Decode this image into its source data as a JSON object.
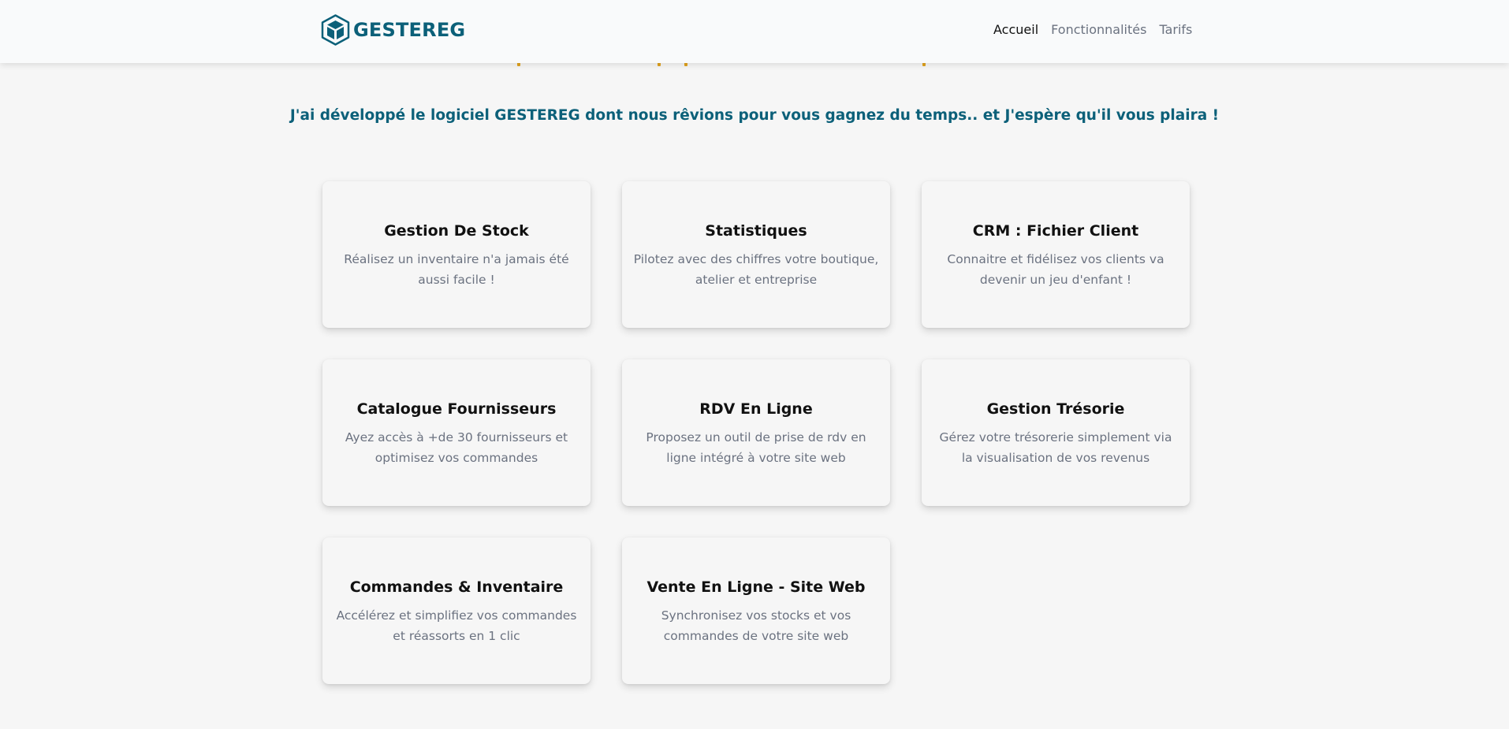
{
  "header": {
    "brand_name": "GESTEREG",
    "brand_colors": {
      "primary": "#0c6079",
      "accent": "#e0a21e"
    },
    "logo_icon": "cube-icon",
    "nav": [
      {
        "label": "Accueil",
        "active": true
      },
      {
        "label": "Fonctionnalités",
        "active": false
      },
      {
        "label": "Tarifs",
        "active": false
      }
    ]
  },
  "intro": {
    "subtitle": "J'ai développé le logiciel GESTEREG dont nous rêvions pour vous gagnez du temps.. et J'espère qu'il vous plaira !"
  },
  "features": [
    {
      "title": "Gestion De Stock",
      "description": "Réalisez un inventaire n'a jamais été aussi facile !"
    },
    {
      "title": "Statistiques",
      "description": "Pilotez avec des chiffres votre boutique, atelier et entreprise"
    },
    {
      "title": "CRM : Fichier Client",
      "description": "Connaitre et fidélisez vos clients va devenir un jeu d'enfant !"
    },
    {
      "title": "Catalogue Fournisseurs",
      "description": "Ayez accès à +de 30 fournisseurs et optimisez vos commandes"
    },
    {
      "title": "RDV En Ligne",
      "description": "Proposez un outil de prise de rdv en ligne intégré à votre site web"
    },
    {
      "title": "Gestion Trésorie",
      "description": "Gérez votre trésorerie simplement via la visualisation de vos revenus"
    },
    {
      "title": "Commandes & Inventaire",
      "description": "Accélérez et simplifiez vos commandes et réassorts en 1 clic"
    },
    {
      "title": "Vente En Ligne - Site Web",
      "description": "Synchronisez vos stocks et vos commandes de votre site web"
    }
  ]
}
